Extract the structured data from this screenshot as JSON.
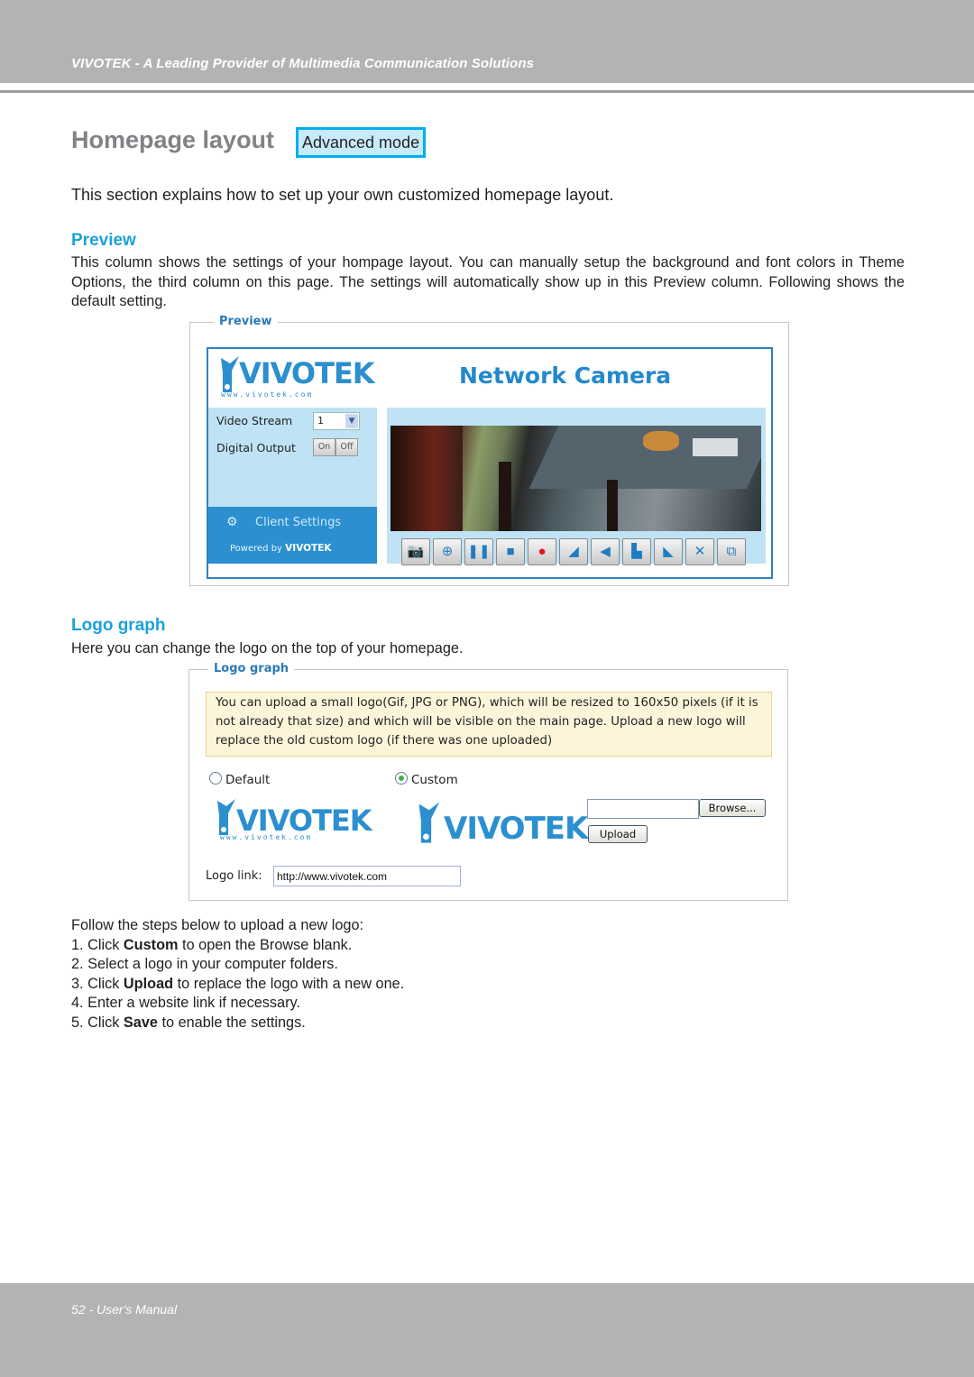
{
  "header": {
    "tagline": "VIVOTEK - A Leading Provider of Multimedia Communication Solutions"
  },
  "title": {
    "text": "Homepage layout",
    "badge": "Advanced mode"
  },
  "intro": "This section explains how to set up your own customized homepage layout.",
  "preview_section": {
    "heading": "Preview",
    "paragraph": "This column shows the settings of your hompage layout. You can manually setup the background and font colors in Theme Options, the third column on this page. The settings will automatically show up in this Preview column. Following shows the default setting.",
    "panel": {
      "legend": "Preview",
      "logo_text": "VIVOTEK",
      "logo_url": "www.vivotek.com",
      "camera_title": "Network Camera",
      "video_stream_label": "Video Stream",
      "video_stream_value": "1",
      "digital_output_label": "Digital Output",
      "on_label": "On",
      "off_label": "Off",
      "client_settings": "Client Settings",
      "powered_by": "Powered by",
      "powered_brand": "VIVOTEK",
      "toolbar": [
        {
          "icon": "camera-icon",
          "glyph": "📷"
        },
        {
          "icon": "zoom-in-icon",
          "glyph": "⊕"
        },
        {
          "icon": "pause-icon",
          "glyph": "❚❚"
        },
        {
          "icon": "stop-icon",
          "glyph": "■"
        },
        {
          "icon": "record-icon",
          "glyph": "●"
        },
        {
          "icon": "volume-icon",
          "glyph": "◢"
        },
        {
          "icon": "mute-icon",
          "glyph": "◀"
        },
        {
          "icon": "talk-icon",
          "glyph": "▙"
        },
        {
          "icon": "microphone-icon",
          "glyph": "◣"
        },
        {
          "icon": "mic-mute-icon",
          "glyph": "✕"
        },
        {
          "icon": "fullscreen-icon",
          "glyph": "⧉"
        }
      ]
    }
  },
  "logo_section": {
    "heading": "Logo graph",
    "paragraph": "Here you can change the logo on the top of your homepage.",
    "panel": {
      "legend": "Logo graph",
      "note": "You can upload a small logo(Gif, JPG or PNG), which will be resized to 160x50 pixels (if it is not already that size) and which will be visible on the main page. Upload a new logo will replace the old custom logo (if there was one uploaded)",
      "default_label": "Default",
      "custom_label": "Custom",
      "default_checked": false,
      "custom_checked": true,
      "logo_text": "VIVOTEK",
      "logo_url": "www.vivotek.com",
      "file_value": "",
      "browse_label": "Browse...",
      "upload_label": "Upload",
      "logo_link_label": "Logo link:",
      "logo_link_value": "http://www.vivotek.com"
    }
  },
  "steps": {
    "intro": "Follow the steps below to upload a new logo:",
    "items": [
      {
        "prefix": "1. Click ",
        "bold": "Custom",
        "suffix": " to open the Browse blank."
      },
      {
        "prefix": "2. Select a logo in your computer folders.",
        "bold": "",
        "suffix": ""
      },
      {
        "prefix": "3. Click ",
        "bold": "Upload",
        "suffix": " to replace the logo with a new one."
      },
      {
        "prefix": "4. Enter a website link if necessary.",
        "bold": "",
        "suffix": ""
      },
      {
        "prefix": "5. Click ",
        "bold": "Save",
        "suffix": " to enable the settings."
      }
    ]
  },
  "footer": {
    "page_label": "52 - User's Manual"
  },
  "colors": {
    "accent": "#1ba1dc",
    "band": "#b2b3b5",
    "badge_border": "#00aeef",
    "badge_fill": "#c8ebfa"
  }
}
